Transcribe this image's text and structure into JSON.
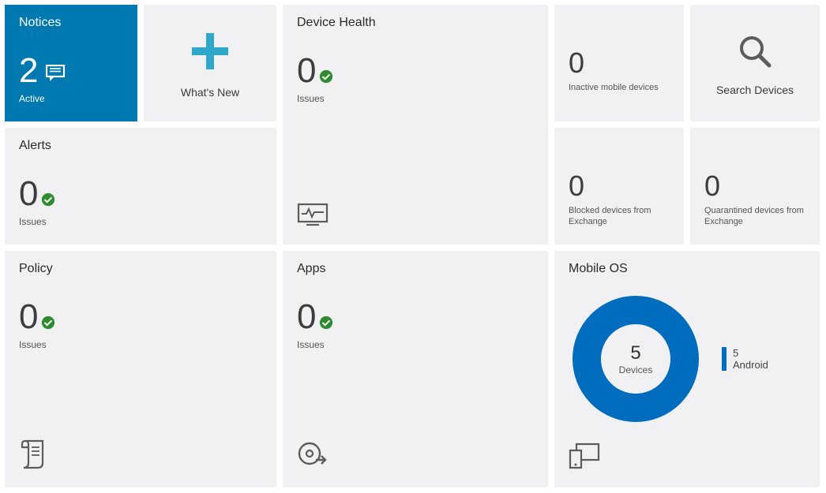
{
  "notices": {
    "title": "Notices",
    "count": "2",
    "sub": "Active"
  },
  "whatsnew": {
    "label": "What's New"
  },
  "devicehealth": {
    "title": "Device Health",
    "count": "0",
    "sub": "Issues"
  },
  "inactive": {
    "count": "0",
    "sub": "Inactive mobile devices"
  },
  "search": {
    "label": "Search Devices"
  },
  "alerts": {
    "title": "Alerts",
    "count": "0",
    "sub": "Issues"
  },
  "blocked": {
    "count": "0",
    "sub": "Blocked devices from Exchange"
  },
  "quarantined": {
    "count": "0",
    "sub": "Quarantined devices from Exchange"
  },
  "policy": {
    "title": "Policy",
    "count": "0",
    "sub": "Issues"
  },
  "apps": {
    "title": "Apps",
    "count": "0",
    "sub": "Issues"
  },
  "mobileos": {
    "title": "Mobile OS",
    "total": "5",
    "total_label": "Devices",
    "legend_count": "5",
    "legend_label": "Android"
  },
  "chart_data": {
    "type": "pie",
    "title": "Mobile OS",
    "categories": [
      "Android"
    ],
    "values": [
      5
    ],
    "total": 5,
    "total_label": "Devices",
    "colors": [
      "#006cbe"
    ]
  }
}
